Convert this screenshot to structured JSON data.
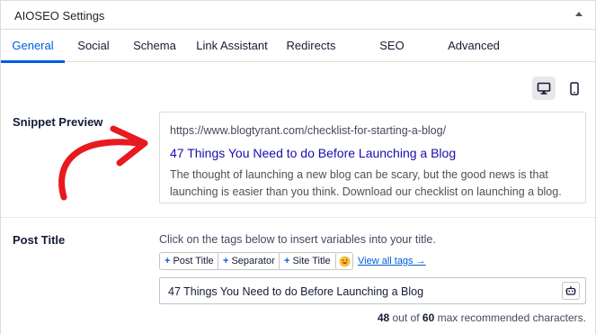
{
  "panel": {
    "title": "AIOSEO Settings"
  },
  "tabs": [
    {
      "label": "General",
      "active": true
    },
    {
      "label": "Social"
    },
    {
      "label": "Schema"
    },
    {
      "label": "Link Assistant"
    },
    {
      "label": "Redirects"
    },
    {
      "label": "SEO Revisions"
    },
    {
      "label": "Advanced"
    }
  ],
  "device_toggle": {
    "selected": "desktop",
    "icons": [
      "desktop-icon",
      "mobile-icon"
    ]
  },
  "snippet": {
    "label": "Snippet Preview",
    "url": "https://www.blogtyrant.com/checklist-for-starting-a-blog/",
    "title": "47 Things You Need to do Before Launching a Blog",
    "description": "The thought of launching a new blog can be scary, but the good news is that launching is easier than you think. Download our checklist on launching a blog."
  },
  "post_title": {
    "label": "Post Title",
    "help": "Click on the tags below to insert variables into your title.",
    "tags": [
      "Post Title",
      "Separator",
      "Site Title"
    ],
    "view_all": "View all tags →",
    "value": "47 Things You Need to do Before Launching a Blog",
    "count": {
      "current": "48",
      "middle": " out of ",
      "max": "60",
      "suffix": " max recommended characters."
    }
  },
  "colors": {
    "accent": "#005ae0",
    "snippet_title": "#1a0dab",
    "annotation_arrow": "#e8191f"
  }
}
